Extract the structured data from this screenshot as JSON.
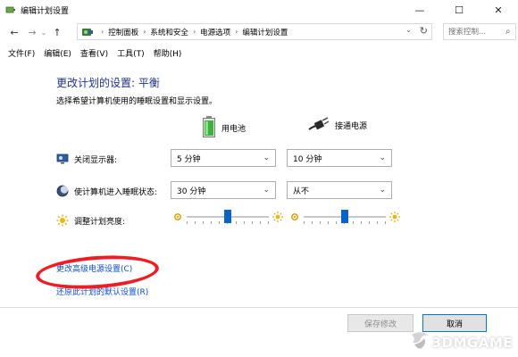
{
  "window": {
    "title": "编辑计划设置",
    "controls": {
      "minimize": "—",
      "maximize": "☐",
      "close": "✕"
    }
  },
  "nav": {
    "back": "←",
    "forward": "→",
    "history": "⌄",
    "up": "↑",
    "breadcrumbs": [
      "控制面板",
      "系统和安全",
      "电源选项",
      "编辑计划设置"
    ],
    "dropdown": "⌄",
    "refresh": "↻",
    "search_placeholder": "搜索控制...",
    "search_icon": "search-icon"
  },
  "menu": {
    "items": [
      "文件(F)",
      "编辑(E)",
      "查看(V)",
      "工具(T)",
      "帮助(H)"
    ]
  },
  "plan": {
    "title": "更改计划的设置: 平衡",
    "description": "选择希望计算机使用的睡眠设置和显示设置。",
    "columns": {
      "battery": "用电池",
      "plugged": "接通电源"
    },
    "rows": [
      {
        "label": "关闭显示器:",
        "icon": "monitor-icon",
        "battery": "5 分钟",
        "plugged": "10 分钟"
      },
      {
        "label": "使计算机进入睡眠状态:",
        "icon": "moon-icon",
        "battery": "30 分钟",
        "plugged": "从不"
      }
    ],
    "brightness": {
      "label": "调整计划亮度:",
      "battery_level": 0.5,
      "plugged_level": 0.5
    }
  },
  "links": {
    "advanced": "更改高级电源设置(C)",
    "restore": "还原此计划的默认设置(R)"
  },
  "buttons": {
    "save": "保存修改",
    "cancel": "取消"
  },
  "watermark": {
    "text": "3DMGAME"
  },
  "colors": {
    "title_blue": "#1e3287",
    "link_blue": "#0a4dcc",
    "slider_thumb": "#0a64c8",
    "highlight_red": "#ee1d23",
    "battery_green": "#3cb43c"
  }
}
